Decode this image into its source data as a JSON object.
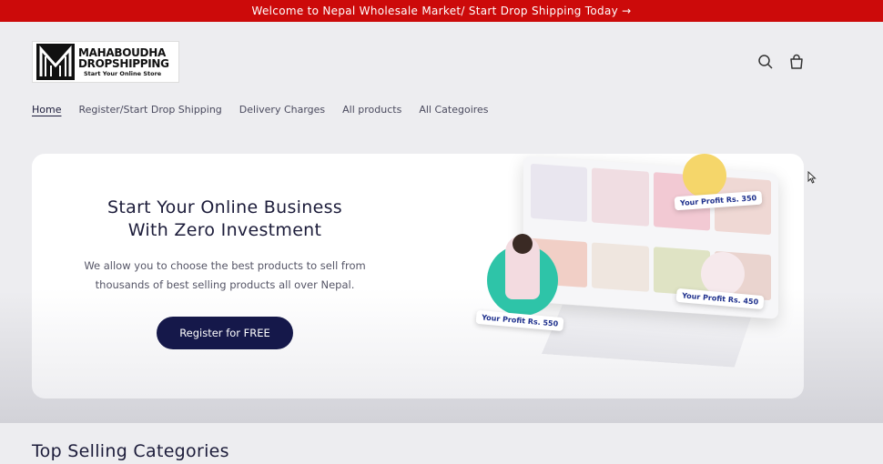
{
  "announcement": {
    "text": "Welcome to Nepal Wholesale Market/ Start Drop Shipping Today →"
  },
  "logo": {
    "line1": "MAHABOUDHA",
    "line2": "DROPSHIPPING",
    "tagline": "Start Your Online Store"
  },
  "header": {
    "search_icon": "search-icon",
    "cart_icon": "cart-icon"
  },
  "nav": {
    "items": [
      {
        "label": "Home"
      },
      {
        "label": "Register/Start Drop Shipping"
      },
      {
        "label": "Delivery Charges"
      },
      {
        "label": "All products"
      },
      {
        "label": "All Categoires"
      }
    ]
  },
  "hero": {
    "title_line1": "Start Your Online Business",
    "title_line2": "With Zero Investment",
    "desc_line1": "We allow you to choose the best products to sell from",
    "desc_line2": "thousands of best selling products all over Nepal.",
    "button_label": "Register for FREE",
    "profit_badges": [
      "Your Profit Rs. 350",
      "Your Profit Rs. 450",
      "Your Profit Rs. 550"
    ]
  },
  "section": {
    "title": "Top Selling Categories"
  },
  "colors": {
    "announcement_bg": "#cc0a0a",
    "button_bg": "#15184a",
    "profit_text": "#1d2f8c",
    "accent_circle": "#2ec4a8"
  }
}
